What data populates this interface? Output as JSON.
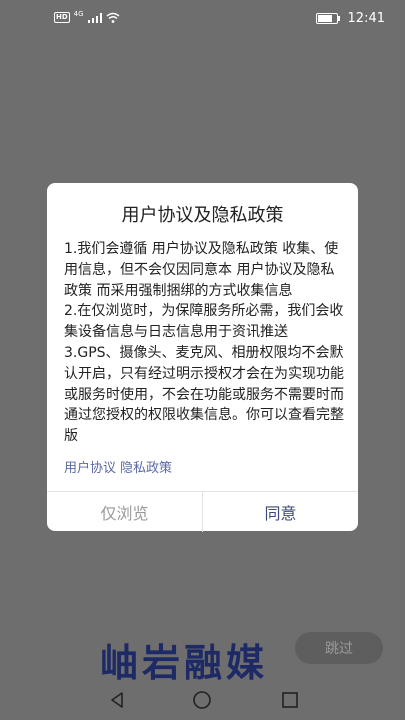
{
  "statusbar": {
    "hd": "HD",
    "network": "4G",
    "time": "12:41",
    "battery_level": 0.8
  },
  "dialog": {
    "title": "用户协议及隐私政策",
    "body": [
      "1.我们会遵循 用户协议及隐私政策 收集、使用信息，但不会仅因同意本 用户协议及隐私政策 而采用强制捆绑的方式收集信息",
      "2.在仅浏览时，为保障服务所必需，我们会收集设备信息与日志信息用于资讯推送",
      "3.GPS、摄像头、麦克风、相册权限均不会默认开启，只有经过明示授权才会在为实现功能或服务时使用，不会在功能或服务不需要时而通过您授权的权限收集信息。你可以查看完整版"
    ],
    "link_user_agreement": "用户协议",
    "link_privacy_policy": "隐私政策",
    "browse_only_label": "仅浏览",
    "agree_label": "同意"
  },
  "brand": {
    "name": "岫岩融媒"
  },
  "skip_label": "跳过",
  "colors": {
    "overlay": "#6e6e6e",
    "agree_text": "#3d4a7a",
    "link": "#5a6aa8",
    "brand": "#1e2a66"
  },
  "icons": {
    "signal": "signal-bars-icon",
    "wifi": "wifi-icon",
    "battery": "battery-icon",
    "back": "back-triangle-icon",
    "home": "home-circle-icon",
    "recent": "recent-square-icon"
  }
}
